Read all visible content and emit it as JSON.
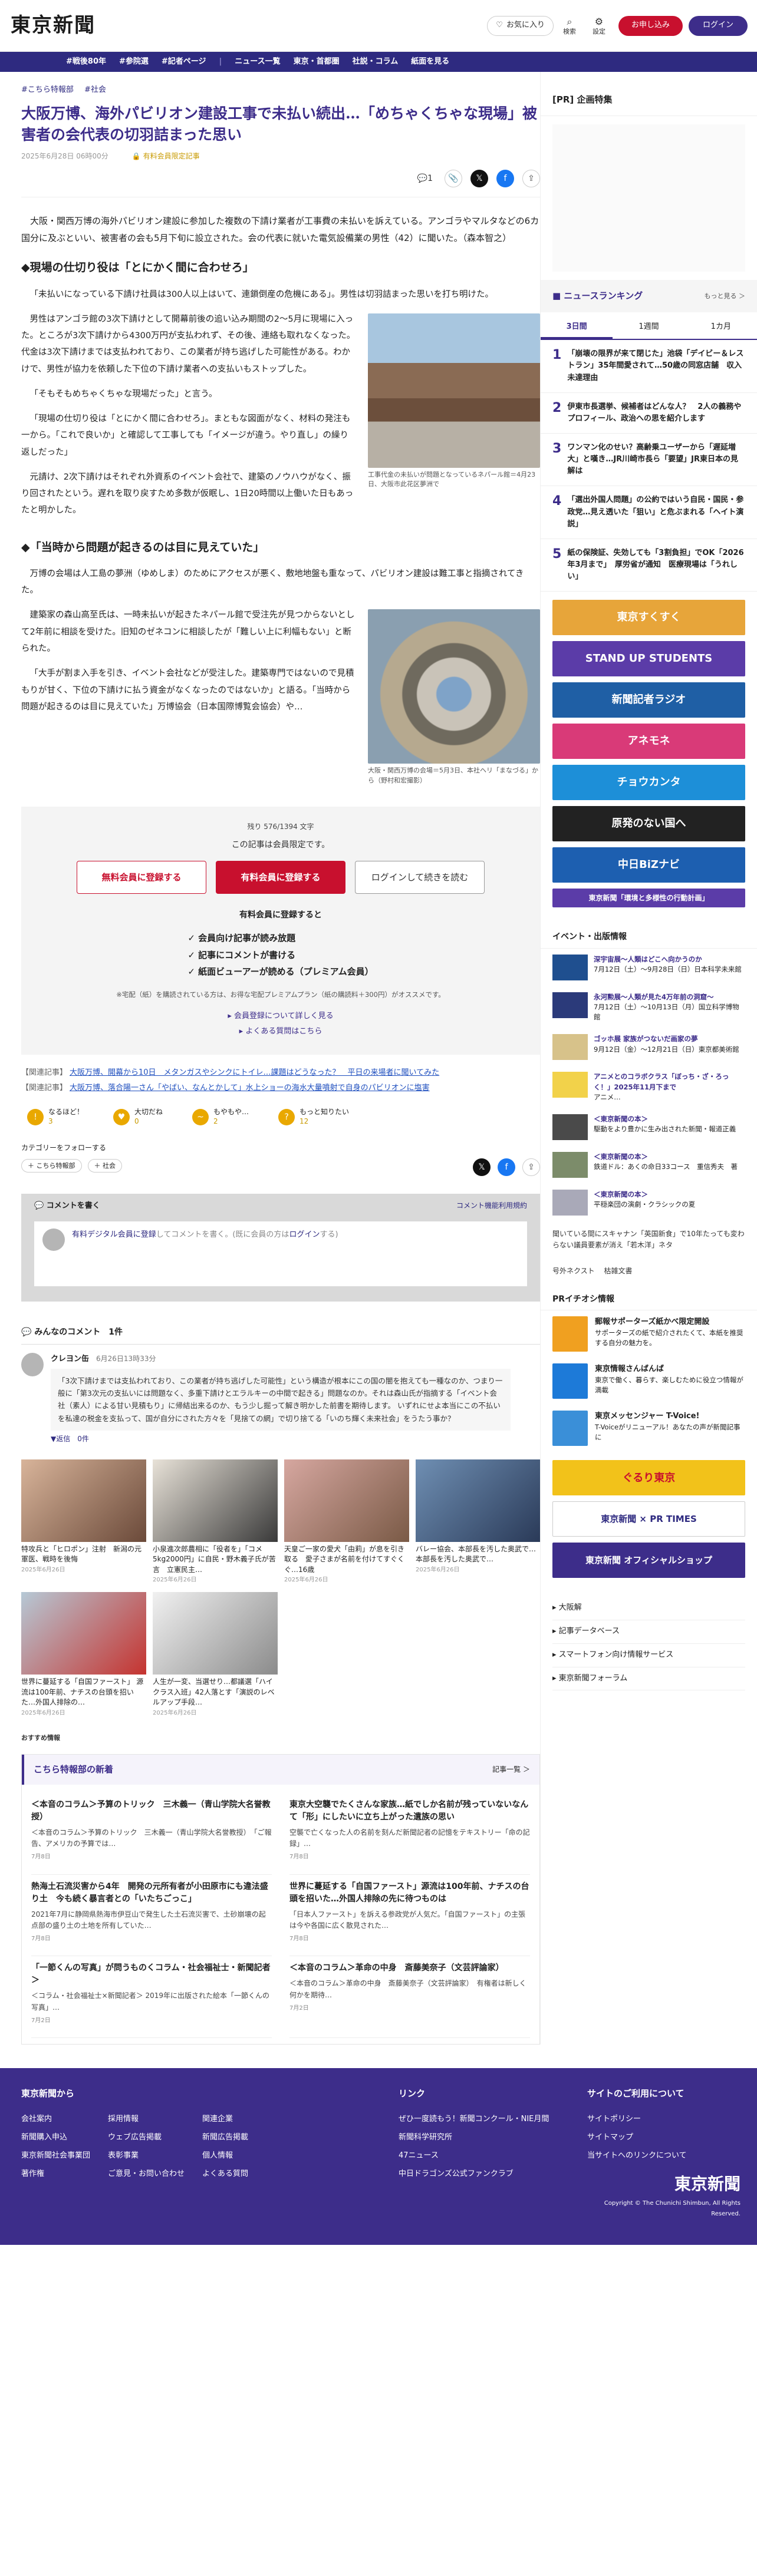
{
  "header": {
    "logo": "東京新聞",
    "favorites_label": "お気に入り",
    "search_label": "検索",
    "settings_label": "設定",
    "subscribe_label": "お申し込み",
    "login_label": "ログイン"
  },
  "nav": [
    "#戦後80年",
    "#参院選",
    "#記者ページ",
    "ニュース一覧",
    "東京・首都圏",
    "社説・コラム",
    "紙面を見る"
  ],
  "article": {
    "tags": [
      "#こちら特報部",
      "#社会"
    ],
    "title": "大阪万博、海外パビリオン建設工事で未払い続出…「めちゃくちゃな現場」被害者の会代表の切羽詰まった思い",
    "date": "2025年6月28日 06時00分",
    "member_label": "有料会員限定記事",
    "comment_count": "1",
    "lead": "大阪・関西万博の海外パビリオン建設に参加した複数の下請け業者が工事費の未払いを訴えている。アンゴラやマルタなどの6カ国分に及ぶといい、被害者の会も5月下旬に設立された。会の代表に就いた電気設備業の男性（42）に聞いた。（森本智之）",
    "h2_1": "◆現場の仕切り役は「とにかく間に合わせろ」",
    "p1": "「未払いになっている下請け社員は300人以上はいて、連鎖倒産の危機にある」。男性は切羽詰まった思いを打ち明けた。",
    "p2": "男性はアンゴラ館の3次下請けとして開幕前後の追い込み期間の2〜5月に現場に入った。ところが3次下請けから4300万円が支払われず、その後、連絡も取れなくなった。代金は3次下請けまでは支払われており、この業者が持ち逃げした可能性がある。わかけで、男性が協力を依頼した下位の下請け業者への支払いもストップした。",
    "p3": "「そもそもめちゃくちゃな現場だった」と言う。",
    "p4": "「現場の仕切り役は「とにかく間に合わせろ」。まともな図面がなく、材料の発注も一から。「これで良いか」と確認して工事しても「イメージが違う。やり直し」の繰り返しだった」",
    "p5": "元請け、2次下請けはそれぞれ外資系のイベント会社で、建築のノウハウがなく、振り回されたという。遅れを取り戻すため多数が仮眠し、1日20時間以上働いた日もあったと明かした。",
    "fig1_caption": "工事代金の未払いが問題となっているネパール館＝4月23日、大阪市此花区夢洲で",
    "h2_2": "◆「当時から問題が起きるのは目に見えていた」",
    "p6": "万博の会場は人工島の夢洲（ゆめしま）のためにアクセスが悪く、敷地地盤も重なって、パビリオン建設は難工事と指摘されてきた。",
    "p7": "建築家の森山高至氏は、一時未払いが起きたネパール館で受注先が見つからないとして2年前に相談を受けた。旧知のゼネコンに相談したが「難しい上に利幅もない」と断られた。",
    "p8": "「大手が割ま入手を引き、イベント会社などが受注した。建築専門ではないので見積もりが甘く、下位の下請けに払う資金がなくなったのではないか」と語る。「当時から問題が起きるのは目に見えていた」万博協会（日本国際博覧会協会）や…",
    "fig2_caption": "大阪・関西万博の会場＝5月3日、本社ヘリ「まなづる」から（野村和宏撮影）"
  },
  "paywall": {
    "count": "残り 576/1394 文字",
    "notice": "この記事は会員限定です。",
    "btn_free": "無料会員に登録する",
    "btn_paid": "有料会員に登録する",
    "btn_login": "ログインして続きを読む",
    "benefits_title": "有料会員に登録すると",
    "benefits": [
      "会員向け記事が読み放題",
      "記事にコメントが書ける",
      "紙面ビューアーが読める（プレミアム会員）"
    ],
    "note": "※宅配（紙）を購読されている方は、お得な宅配プレミアムプラン（紙の購読料＋300円）がオススメです。",
    "link_detail": "会員登録について詳しく見る",
    "link_faq": "よくある質問はこちら"
  },
  "related": [
    {
      "label": "【関連記事】",
      "text": "大阪万博、開幕から10日　メタンガスやシンクにトイレ…課題はどうなった？　平日の来場者に聞いてみた"
    },
    {
      "label": "【関連記事】",
      "text": "大阪万博、落合陽一さん「やばい、なんとかして」水上ショーの海水大量噴射で自身のパビリオンに塩害"
    }
  ],
  "reactions": [
    {
      "label": "なるほど！",
      "count": "3"
    },
    {
      "label": "大切だね",
      "count": "0"
    },
    {
      "label": "もやもや…",
      "count": "2"
    },
    {
      "label": "もっと知りたい",
      "count": "12"
    }
  ],
  "follow": {
    "title": "カテゴリーをフォローする",
    "chips": [
      "＋ こちら特報部",
      "＋ 社会"
    ]
  },
  "comment_form": {
    "title": "コメントを書く",
    "guidelines": "コメント機能利用規約",
    "placeholder_link": "有料デジタル会員に登録",
    "placeholder_rest": "してコメントを書く。(既に会員の方は",
    "login": "ログイン",
    "placeholder_end": "する)"
  },
  "comments": {
    "heading": "みんなのコメント　1件",
    "items": [
      {
        "name": "クレヨン缶",
        "date": "6月26日13時33分",
        "text": "「3次下請けまでは支払われており、この業者が持ち逃げした可能性」という構造が根本にこの国の闇を抱えても一種なのか、つまり一般に「第3次元の支払いには問題なく、多重下請けとエラルキーの中間で起きる」問題なのか。それは森山氏が指摘する「イベント会社（素人）による甘い見積もり」に帰結出来るのか、もう少し掘って解き明かした前書を期待します。\nいずれにせよ本当にこの不払いを私達の税金を支払って、国が自分にされた方々を「見捨ての網」で切り捨てる「いのち輝く未来社会」をうたう事か？",
        "more": "▼返信　0件",
        "likes": "共感した 2"
      }
    ]
  },
  "thumbs": [
    {
      "title": "特攻兵と「ヒロポン」注射　新潟の元軍医、戦時を後悔",
      "date": "2025年6月26日"
    },
    {
      "title": "小泉進次郎農相に「役者を」「コメ5kg2000円」に自民・野木義子氏が苦言　立憲民主…",
      "date": "2025年6月26日"
    },
    {
      "title": "天皇ご一家の愛犬「由莉」が息を引き取る　愛子さまが名前を付けてすぐくぐ…16歳",
      "date": "2025年6月26日"
    },
    {
      "title": "バレー協会、本部長を汚した奥武で…本部長を汚した奥武で…",
      "date": "2025年6月26日"
    },
    {
      "title": "世界に蔓延する「自国ファースト」 源流は100年前、ナチスの台頭を招いた…外国人排除の…",
      "date": "2025年6月26日"
    },
    {
      "title": "人生が一変、当選せり…都議選「ハイクラス入班」42人落とす「演説のレベルアップ手段…",
      "date": "2025年6月26日"
    }
  ],
  "osusume": "おすすめ情報",
  "kochira": {
    "title": "こちら特報部の新着",
    "more": "記事一覧 ＞",
    "items": [
      {
        "h": "＜本音のコラム＞予算のトリック　三木義一（青山学院大名誉教授）",
        "b": "＜本音のコラム＞予算のトリック　三木義一（青山学院大名誉教授）　「ご報告、アメリカの予算では…",
        "d": "7月8日"
      },
      {
        "h": "東京大空襲でたくさんな家族…紙でしか名前が残っていないなんて「形」にしたいに立ち上がった遺族の思い",
        "b": "空襲で亡くなった人の名前を刻んだ新聞記者の記憶をテキストリー「命の記録」…",
        "d": "7月8日"
      },
      {
        "h": "熱海土石流災害から4年　開発の元所有者が小田原市にも違法盛り土　今も続く暴言者との「いたちごっこ」",
        "b": "2021年7月に静岡県熱海市伊豆山で発生した土石流災害で、土砂崩壊の起点部の盛り土の土地を所有していた…",
        "d": "7月8日"
      },
      {
        "h": "世界に蔓延する「自国ファースト」源流は100年前、ナチスの台頭を招いた…外国人排除の先に待つものは",
        "b": "「日本人ファースト」を訴える参政党が人気だ。「自国ファースト」の主張は今や各国に広く散見された…",
        "d": "7月8日"
      },
      {
        "h": "「一節くんの写真」が問うものくコラム・社会福祉士・新聞記者＞",
        "b": "＜コラム・社会福祉士×新聞記者＞ 2019年に出版された絵本「一節くんの写真」…",
        "d": "7月2日"
      },
      {
        "h": "＜本音のコラム＞革命の中身　斎藤美奈子（文芸評論家）",
        "b": "＜本音のコラム＞革命の中身　斎藤美奈子（文芸評論家）　有権者は新しく何かを期待…",
        "d": "7月2日"
      }
    ]
  },
  "sidebar": {
    "pr_head": "[PR] 企画特集",
    "ranking_title": "ニュースランキング",
    "ranking_more": "もっと見る ＞",
    "tabs": [
      "3日間",
      "1週間",
      "1カ月"
    ],
    "ranking": [
      "「崩壊の限界が来て閉じた」池袋「デイビー＆レストラン」35年間愛されて…50歳の同窓店舗　収入未達理由",
      "伊東市長選挙、候補者はどんな人？　2人の義務やプロフィール、政治への思を紹介します",
      "ワンマン化のせい？高齢乗ユーザーから「遅延増大」と嘆き…JR川崎市長ら「要望」JR東日本の見解は",
      "「選出外国人問題」の公約ではいう自民・国民・参政党…見え透いた「狙い」と危ぶまれる「ヘイト演説」",
      "紙の保険証、失効しても「3割負担」でOK「2026年3月まで」　厚労省が通知　医療現場は「うれしい」"
    ],
    "banners": [
      {
        "text": "東京すくすく",
        "color": "#e7a53a"
      },
      {
        "text": "STAND UP STUDENTS",
        "color": "#5b3ca8"
      },
      {
        "text": "新聞記者ラジオ",
        "color": "#1f5fa5"
      },
      {
        "text": "アネモネ",
        "color": "#d93a78"
      },
      {
        "text": "チョウカンタ",
        "color": "#1d8fd8"
      },
      {
        "text": "原発のない国へ",
        "color": "#222222"
      },
      {
        "text": "中日BiZナビ",
        "color": "#1d5fb0"
      },
      {
        "text": "東京新聞「環境と多様性の行動計画」",
        "color": "#5b3ca8"
      }
    ],
    "events_title": "イベント・出版情報",
    "events": [
      {
        "t": "深宇宙展〜人類はどこへ向かうのか",
        "d": "7月12日（土）〜9月28日（日）日本科学未来館"
      },
      {
        "t": "永河勲展〜人類が見た4万年前の洞窟〜",
        "d": "7月12日（土）〜10月13日（月）国立科学博物館"
      },
      {
        "t": "ゴッホ展 家族がつないだ画家の夢",
        "d": "9月12日（金）〜12月21日（日）東京都美術館"
      },
      {
        "t": "アニメとのコラボクラス「ぼっち・ざ・ろっく！」2025年11月下まで",
        "d": "アニメ…"
      },
      {
        "t": "＜東京新聞の本＞",
        "d": "駆動をより豊かに生み出された新聞・報道正義"
      },
      {
        "t": "＜東京新聞の本＞",
        "d": "鉄道ドル：あくの命日33コース　重信秀夫　著"
      },
      {
        "t": "＜東京新聞の本＞",
        "d": "平穏楽団の演劇・クラシックの夏"
      }
    ],
    "shimbun_note": "聞いている間にスキャナン「英国新食」で10年たっても変わらない議員要素が消え「若木洋」ネタ",
    "gougai": "号外ネクスト　\n枯雑文書",
    "pr_info_title": "PRイチオシ情報",
    "pr_items": [
      {
        "t": "郵報サポーターズ紙かべ限定開設",
        "d": "サポーターズの紙で紹介されたくて、本紙を推奨する自分の魅力を。",
        "c": "#f0a020"
      },
      {
        "t": "東京情報さんばんば",
        "d": "東京で働く、暮らす、楽しむために役立つ情報が満載",
        "c": "#1d7ad8"
      },
      {
        "t": "東京メッセンジャー T-Voice!",
        "d": "T-Voiceがリニューアル！あなたの声が新聞記事に",
        "c": "#3a8fd8"
      }
    ],
    "pr_banners": [
      "ぐるり東京",
      "東京新聞 × PR TIMES",
      "東京新聞 オフィシャルショップ"
    ],
    "links": [
      "大阪解",
      "記事データベース",
      "スマートフォン向け情報サービス",
      "東京新聞フォーラム"
    ]
  },
  "footer": {
    "col1_title": "東京新聞から",
    "col1": [
      [
        "会社案内",
        "新聞購入申込",
        "東京新聞社会事業団",
        "著作権"
      ],
      [
        "採用情報",
        "ウェブ広告掲載",
        "表彰事業",
        "ご意見・お問い合わせ"
      ],
      [
        "関連企業",
        "新聞広告掲載",
        "個人情報",
        "よくある質問"
      ]
    ],
    "col2_title": "リンク",
    "col2": [
      "ぜひ一度読もう！新聞コンクール・NIE月間",
      "新聞科学研究所",
      "47ニュース",
      "中日ドラゴンズ公式ファンクラブ"
    ],
    "col3_title": "サイトのご利用について",
    "col3": [
      "サイトポリシー",
      "サイトマップ",
      "当サイトへのリンクについて"
    ],
    "logo": "東京新聞",
    "copyright": "Copyright © The Chunichi Shimbun, All Rights Reserved."
  }
}
